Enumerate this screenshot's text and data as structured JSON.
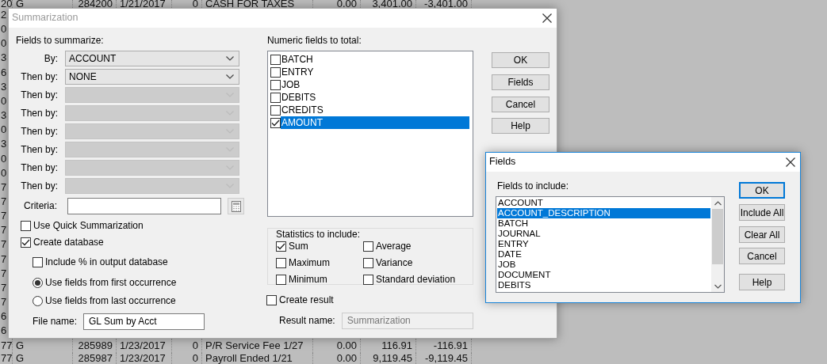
{
  "background_sheet": {
    "rows": [
      {
        "cells": [
          "20",
          "G",
          "284200",
          "1/21/2017",
          "0",
          "CASH FOR TAXES",
          "0.00",
          "3,401.00",
          "-3,401.00"
        ]
      },
      {
        "cells": [
          "2"
        ]
      },
      {
        "cells": [
          "0"
        ]
      },
      {
        "cells": [
          "0"
        ]
      },
      {
        "cells": [
          "3"
        ]
      },
      {
        "cells": [
          "6"
        ]
      },
      {
        "cells": [
          "3"
        ]
      },
      {
        "cells": [
          "0"
        ]
      },
      {
        "cells": [
          "3"
        ]
      },
      {
        "cells": [
          "0"
        ]
      },
      {
        "cells": [
          "3"
        ]
      },
      {
        "cells": [
          "0"
        ]
      },
      {
        "cells": [
          "0"
        ]
      },
      {
        "cells": [
          "7"
        ]
      },
      {
        "cells": [
          "7"
        ]
      },
      {
        "cells": [
          "7"
        ]
      },
      {
        "cells": [
          "7"
        ]
      },
      {
        "cells": [
          "7"
        ]
      },
      {
        "cells": [
          "7"
        ]
      },
      {
        "cells": [
          "7"
        ]
      },
      {
        "cells": [
          "7"
        ]
      },
      {
        "cells": [
          "7"
        ]
      },
      {
        "cells": [
          "6"
        ]
      },
      {
        "cells": [
          "6"
        ]
      },
      {
        "cells": [
          "77",
          "G",
          "285989",
          "1/23/2017",
          "0",
          "P/R Service Fee 1/27",
          "0.00",
          "116.91",
          "-116.91"
        ]
      },
      {
        "cells": [
          "77",
          "G",
          "285987",
          "1/23/2017",
          "0",
          "Payroll Ended 1/21",
          "0.00",
          "9,119.45",
          "-9,119.45"
        ]
      }
    ]
  },
  "summarization_dialog": {
    "title": "Summarization",
    "active": false,
    "fields_label": "Fields to summarize:",
    "sort_fields": [
      {
        "label": "By:",
        "value": "ACCOUNT",
        "disabled": false
      },
      {
        "label": "Then by:",
        "value": "NONE",
        "disabled": false
      },
      {
        "label": "Then by:",
        "disabled": true
      },
      {
        "label": "Then by:",
        "disabled": true
      },
      {
        "label": "Then by:",
        "disabled": true
      },
      {
        "label": "Then by:",
        "disabled": true
      },
      {
        "label": "Then by:",
        "disabled": true
      },
      {
        "label": "Then by:",
        "disabled": true
      }
    ],
    "criteria": {
      "label": "Criteria:"
    },
    "options": [
      {
        "kind": "checkbox",
        "label": "Use Quick Summarization",
        "checked": false
      },
      {
        "kind": "checkbox",
        "label": "Create database",
        "checked": true,
        "children": [
          {
            "kind": "checkbox",
            "label": "Include % in output database",
            "checked": false
          },
          {
            "kind": "radio",
            "label": "Use fields from first occurrence",
            "selected": true
          },
          {
            "kind": "radio",
            "label": "Use fields from last occurrence",
            "selected": false
          }
        ]
      }
    ],
    "file_name": {
      "label": "File name:",
      "value": "GL Sum by Acct"
    },
    "numeric_fields": {
      "label": "Numeric fields to total:",
      "items": [
        {
          "label": "BATCH",
          "checked": false,
          "selected": false
        },
        {
          "label": "ENTRY",
          "checked": false,
          "selected": false
        },
        {
          "label": "JOB",
          "checked": false,
          "selected": false
        },
        {
          "label": "DEBITS",
          "checked": false,
          "selected": false
        },
        {
          "label": "CREDITS",
          "checked": false,
          "selected": false
        },
        {
          "label": "AMOUNT",
          "checked": true,
          "selected": true
        }
      ]
    },
    "statistics": {
      "label": "Statistics to include:",
      "items": [
        {
          "label": "Sum",
          "checked": true
        },
        {
          "label": "Average",
          "checked": false
        },
        {
          "label": "Maximum",
          "checked": false
        },
        {
          "label": "Variance",
          "checked": false
        },
        {
          "label": "Minimum",
          "checked": false
        },
        {
          "label": "Standard deviation",
          "checked": false
        }
      ]
    },
    "create_result": {
      "label": "Create result",
      "checked": false
    },
    "result_name": {
      "label": "Result name:",
      "value": "Summarization",
      "disabled": true
    },
    "buttons": [
      {
        "label": "OK",
        "default": false
      },
      {
        "label": "Fields",
        "default": false
      },
      {
        "label": "Cancel",
        "default": false
      },
      {
        "label": "Help",
        "default": false
      }
    ]
  },
  "fields_dialog": {
    "title": "Fields",
    "active": true,
    "list_label": "Fields to include:",
    "items": [
      {
        "label": "ACCOUNT",
        "selected": false
      },
      {
        "label": "ACCOUNT_DESCRIPTION",
        "selected": true
      },
      {
        "label": "BATCH",
        "selected": false
      },
      {
        "label": "JOURNAL",
        "selected": false
      },
      {
        "label": "ENTRY",
        "selected": false
      },
      {
        "label": "DATE",
        "selected": false
      },
      {
        "label": "JOB",
        "selected": false
      },
      {
        "label": "DOCUMENT",
        "selected": false
      },
      {
        "label": "DEBITS",
        "selected": false
      }
    ],
    "buttons": [
      {
        "label": "OK",
        "default": true
      },
      {
        "label": "Include All",
        "default": false
      },
      {
        "label": "Clear All",
        "default": false
      },
      {
        "label": "Cancel",
        "default": false
      },
      {
        "label": "Help",
        "default": false
      }
    ]
  }
}
